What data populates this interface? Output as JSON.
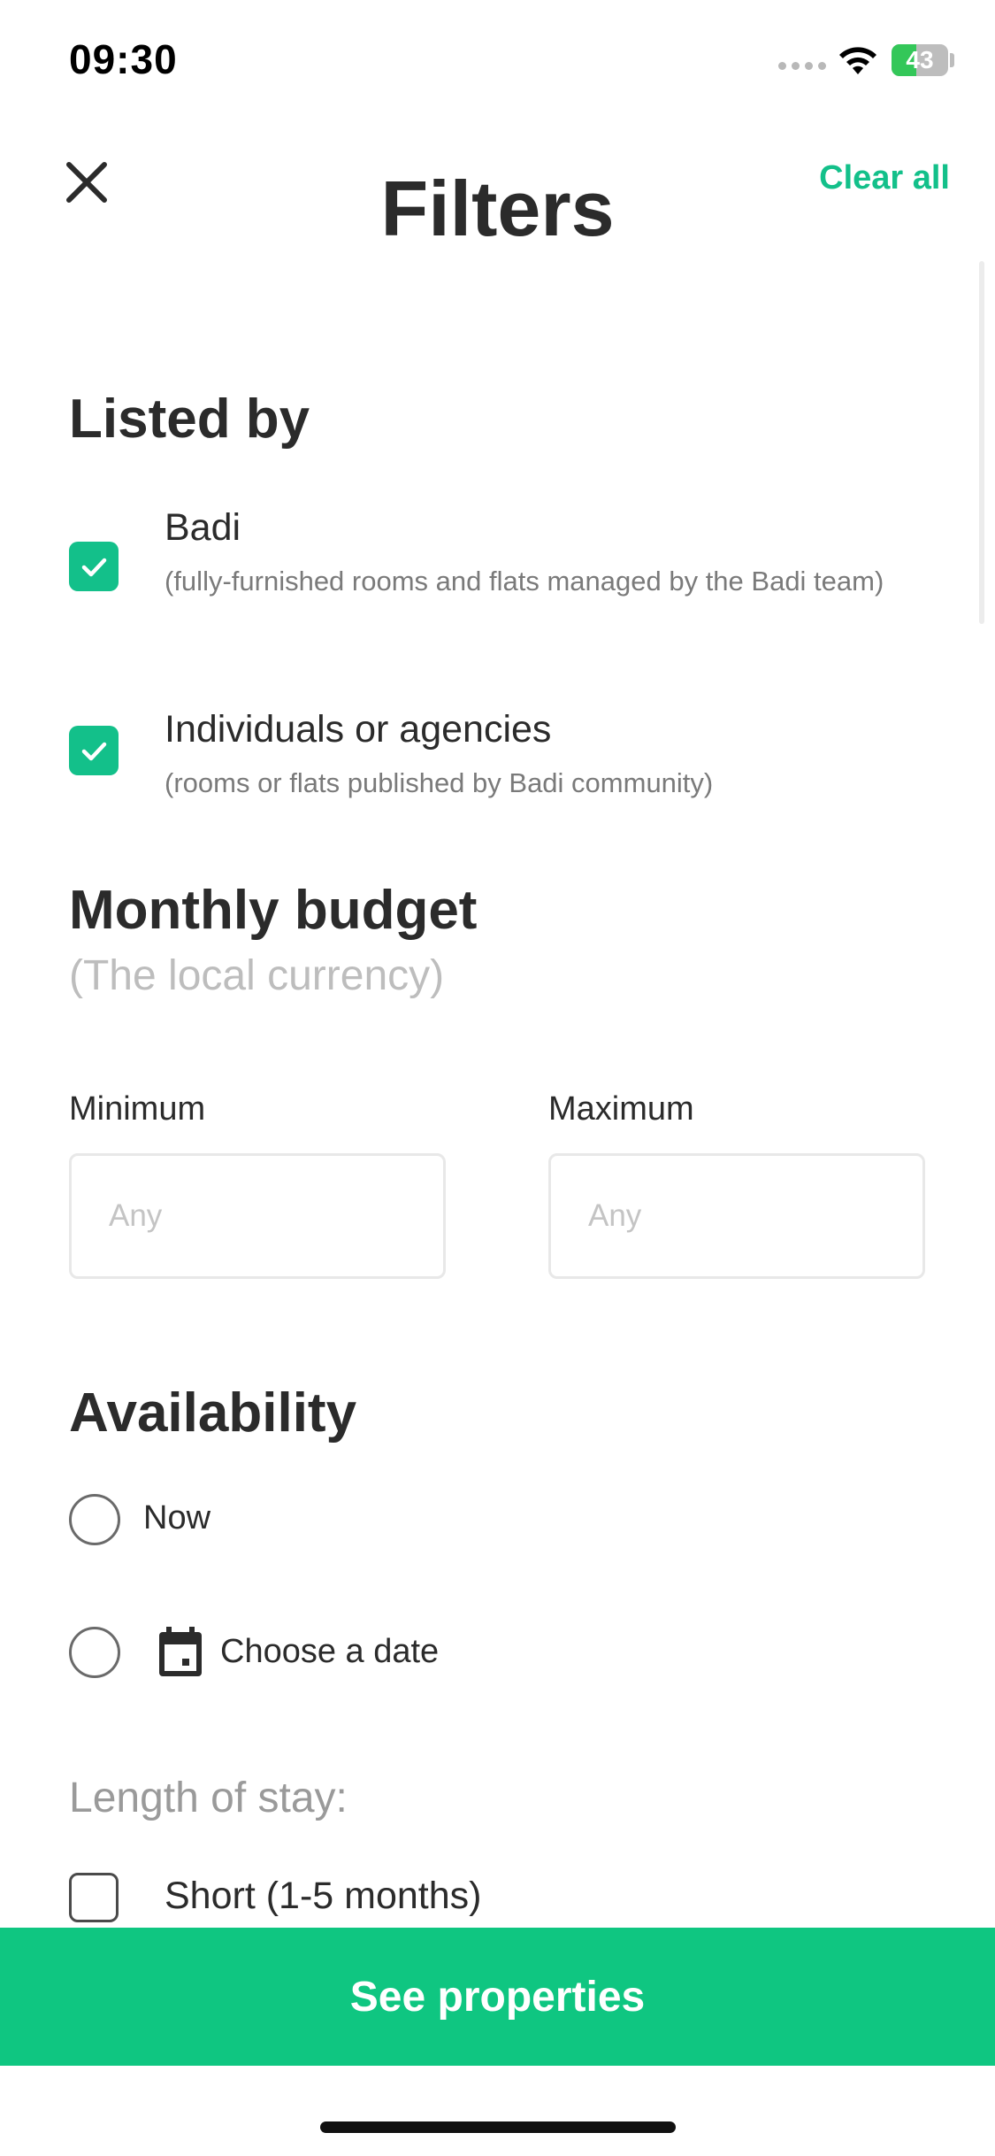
{
  "status_bar": {
    "time": "09:30",
    "battery_percent": "43",
    "battery_level": 0.43,
    "icons": [
      "signal-dots-icon",
      "wifi-icon",
      "battery-icon"
    ]
  },
  "header": {
    "title": "Filters",
    "clear_all_label": "Clear all",
    "close_icon": "close-icon"
  },
  "listed_by": {
    "title": "Listed by",
    "options": [
      {
        "label": "Badi",
        "description": "(fully-furnished rooms and flats managed by the Badi team)",
        "checked": true
      },
      {
        "label": "Individuals or agencies",
        "description": "(rooms or flats published by Badi community)",
        "checked": true
      }
    ]
  },
  "budget": {
    "title": "Monthly budget",
    "subtitle": "(The local currency)",
    "min_label": "Minimum",
    "max_label": "Maximum",
    "min_placeholder": "Any",
    "max_placeholder": "Any",
    "min_value": "",
    "max_value": ""
  },
  "availability": {
    "title": "Availability",
    "options": [
      {
        "label": "Now",
        "selected": false
      },
      {
        "label": "Choose a date",
        "selected": false,
        "icon": "calendar-icon"
      }
    ]
  },
  "length_of_stay": {
    "title": "Length of stay:",
    "options": [
      {
        "label": "Short (1-5 months)",
        "checked": false
      }
    ]
  },
  "footer": {
    "cta_label": "See properties"
  },
  "colors": {
    "accent": "#13c08a",
    "cta_background": "#0fc681",
    "text": "#2b2b2b",
    "muted": "#bdbdbd"
  }
}
